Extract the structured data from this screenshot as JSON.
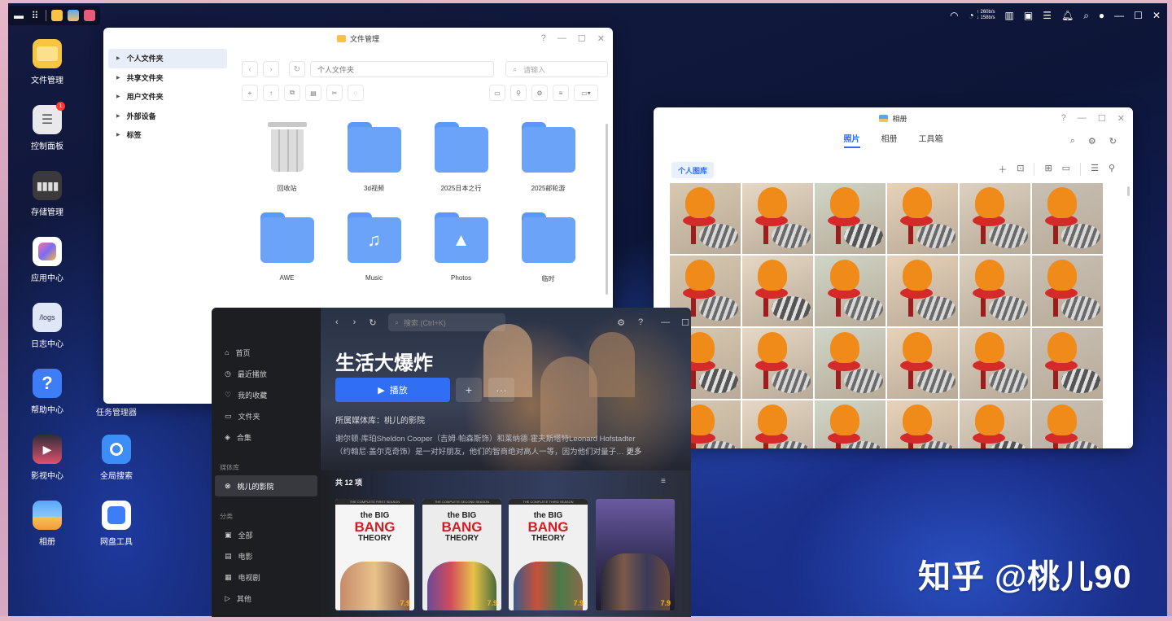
{
  "desktop": {
    "icons": [
      {
        "label": "文件管理"
      },
      {
        "label": "控制面板",
        "badge": "1"
      },
      {
        "label": "存储管理"
      },
      {
        "label": "应用中心"
      },
      {
        "label": "日志中心",
        "glyph": "/logs"
      },
      {
        "label": "帮助中心",
        "glyph": "?"
      },
      {
        "label": "影视中心"
      },
      {
        "label": "相册"
      },
      {
        "label": "任务管理器"
      },
      {
        "label": "全局搜索"
      },
      {
        "label": "网盘工具"
      }
    ],
    "watermark": "知乎 @桃儿90"
  },
  "topbar": {
    "net_up": "↑ 260b/s",
    "net_down": "↓ 158b/s"
  },
  "file_manager": {
    "title": "文件管理",
    "sidebar": [
      {
        "label": "个人文件夹",
        "active": true
      },
      {
        "label": "共享文件夹"
      },
      {
        "label": "用户文件夹"
      },
      {
        "label": "外部设备"
      },
      {
        "label": "标签"
      }
    ],
    "path": "个人文件夹",
    "search_placeholder": "请输入",
    "items": [
      {
        "label": "回收站",
        "type": "trash"
      },
      {
        "label": "3d视频",
        "type": "folder"
      },
      {
        "label": "2025日本之行",
        "type": "folder"
      },
      {
        "label": "2025邮轮游",
        "type": "folder"
      },
      {
        "label": "AWE",
        "type": "folder"
      },
      {
        "label": "Music",
        "type": "music-folder"
      },
      {
        "label": "Photos",
        "type": "photo-folder"
      },
      {
        "label": "临时",
        "type": "folder"
      }
    ]
  },
  "photos": {
    "title": "相册",
    "tabs": [
      {
        "label": "照片",
        "active": true
      },
      {
        "label": "相册"
      },
      {
        "label": "工具箱"
      }
    ],
    "library": "个人图库"
  },
  "media": {
    "search_placeholder": "搜索 (Ctrl+K)",
    "sidebar": {
      "main": [
        {
          "label": "首页",
          "icon": "home-icon"
        },
        {
          "label": "最近播放",
          "icon": "clock-icon"
        },
        {
          "label": "我的收藏",
          "icon": "heart-icon"
        },
        {
          "label": "文件夹",
          "icon": "folder-icon"
        },
        {
          "label": "合集",
          "icon": "stack-icon"
        }
      ],
      "library_section": "媒体库",
      "libraries": [
        {
          "label": "桃儿的影院",
          "active": true
        }
      ],
      "category_section": "分类",
      "categories": [
        {
          "label": "全部"
        },
        {
          "label": "电影"
        },
        {
          "label": "电视剧"
        },
        {
          "label": "其他"
        }
      ]
    },
    "show_title": "生活大爆炸",
    "play_label": "播放",
    "add_label": "+",
    "more_label": "···",
    "library_line": "所属媒体库：桃儿的影院",
    "desc_line1": "谢尔顿·库珀Sheldon Cooper（吉姆·帕森斯饰）和莱纳德·霍夫斯塔特Leonard Hofstadter",
    "desc_line2": "（约翰尼·盖尔克奇饰）是一对好朋友，他们的智商绝对高人一等，因为他们对量子…",
    "more_link": "更多",
    "count_label": "共 12 项",
    "posters": [
      {
        "top": "THE COMPLETE FIRST SEASON",
        "rating": "7.9",
        "color": "#f5f5f5"
      },
      {
        "top": "THE COMPLETE SECOND SEASON",
        "rating": "7.9",
        "color": "#ececec"
      },
      {
        "top": "THE COMPLETE THIRD SEASON",
        "rating": "7.9",
        "color": "#f0f0f0"
      },
      {
        "top": "",
        "rating": "7.9",
        "color": "#2a2850"
      }
    ],
    "logo_line1": "the BIG",
    "logo_line2": "BANG",
    "logo_line3": "THEORY"
  }
}
